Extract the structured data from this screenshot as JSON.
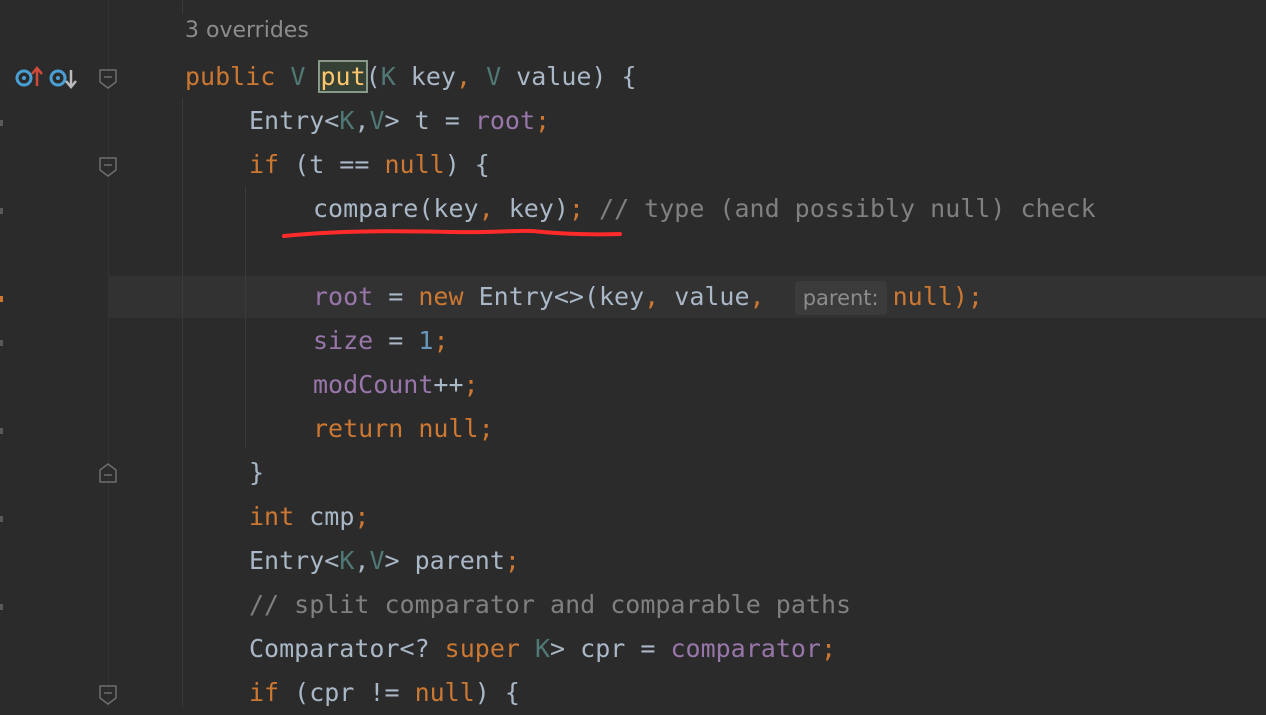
{
  "editor": {
    "overrides_label": "3 overrides",
    "gutter_icons": {
      "implemented_up": "overrides-up-icon",
      "implemented_down": "implemented-down-icon",
      "fold": "fold-icon"
    },
    "inlay_hint": "parent:",
    "lines": {
      "l1": {
        "t1": "public ",
        "t2": "V ",
        "t3": "put",
        "t4": "(",
        "t5": "K ",
        "t6": "key",
        "t7": ", ",
        "t8": "V ",
        "t9": "value) {"
      },
      "l2": {
        "t1": "Entry<",
        "t2": "K",
        "t3": ",",
        "t4": "V",
        "t5": "> t = ",
        "t6": "root",
        "t7": ";"
      },
      "l3": {
        "t1": "if ",
        "t2": "(t == ",
        "t3": "null",
        "t4": ") {"
      },
      "l4": {
        "t1": "compare(key",
        "t2": ", ",
        "t3": "key)",
        "t4": ";",
        "t5": " // type (and possibly null) check"
      },
      "l5": {
        "t1": "root",
        "t2": " = ",
        "t3": "new ",
        "t4": "Entry<>(key",
        "t5": ", ",
        "t6": "value",
        "t7": ",  ",
        "t8": "null",
        "t9": ");"
      },
      "l6": {
        "t1": "size",
        "t2": " = ",
        "t3": "1",
        "t4": ";"
      },
      "l7": {
        "t1": "modCount",
        "t2": "++",
        "t3": ";"
      },
      "l8": {
        "t1": "return ",
        "t2": "null",
        "t3": ";"
      },
      "l9": {
        "t1": "}"
      },
      "l10": {
        "t1": "int ",
        "t2": "cmp",
        "t3": ";"
      },
      "l11": {
        "t1": "Entry<",
        "t2": "K",
        "t3": ",",
        "t4": "V",
        "t5": "> parent",
        "t6": ";"
      },
      "l12": {
        "t1": "// split comparator and comparable paths"
      },
      "l13": {
        "t1": "Comparator<? ",
        "t2": "super ",
        "t3": "K",
        "t4": "> cpr = ",
        "t5": "comparator",
        "t6": ";"
      },
      "l14": {
        "t1": "if ",
        "t2": "(cpr != ",
        "t3": "null",
        "t4": ") {"
      }
    }
  },
  "colors": {
    "background": "#2b2b2b",
    "keyword": "#cc7832",
    "field": "#9876aa",
    "number": "#6897bb",
    "type_param": "#507874",
    "comment": "#808080",
    "annotation_underline": "#ff2a2a"
  }
}
